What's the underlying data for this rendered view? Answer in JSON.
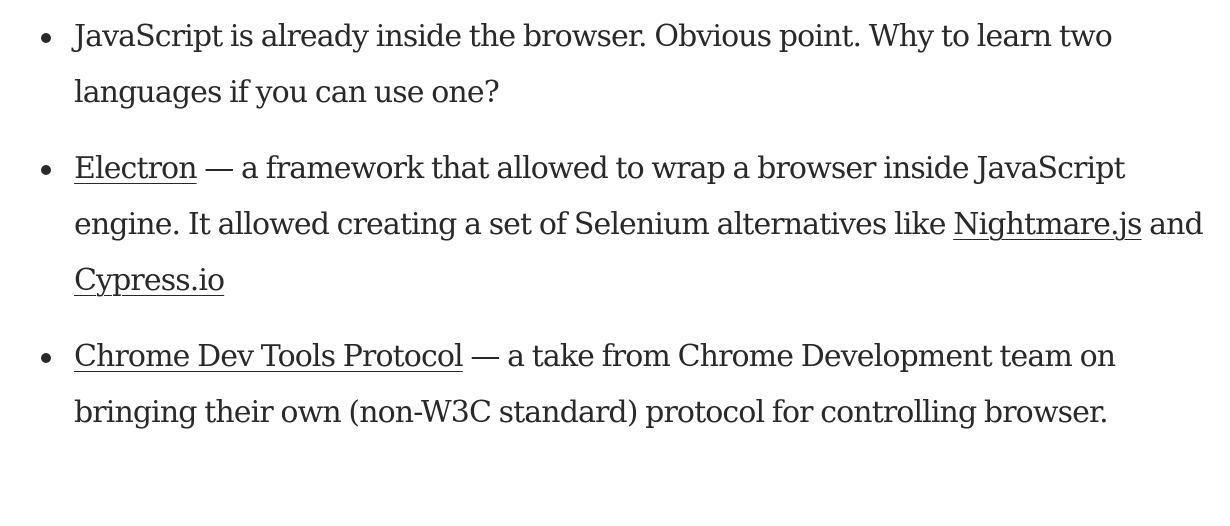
{
  "items": [
    {
      "text": "JavaScript is already inside the browser. Obvious point. Why to learn two languages if you can use one?"
    },
    {
      "link1": "Electron",
      "text1": " — a framework that allowed to wrap a browser inside JavaScript engine. It allowed creating a set of Selenium alternatives like ",
      "link2": "Nightmare.js",
      "text2": " and ",
      "link3": "Cypress.io"
    },
    {
      "link1": "Chrome Dev Tools Protocol",
      "text1": " — a take from Chrome Development team on bringing their own (non-W3C standard) protocol for controlling browser."
    }
  ]
}
